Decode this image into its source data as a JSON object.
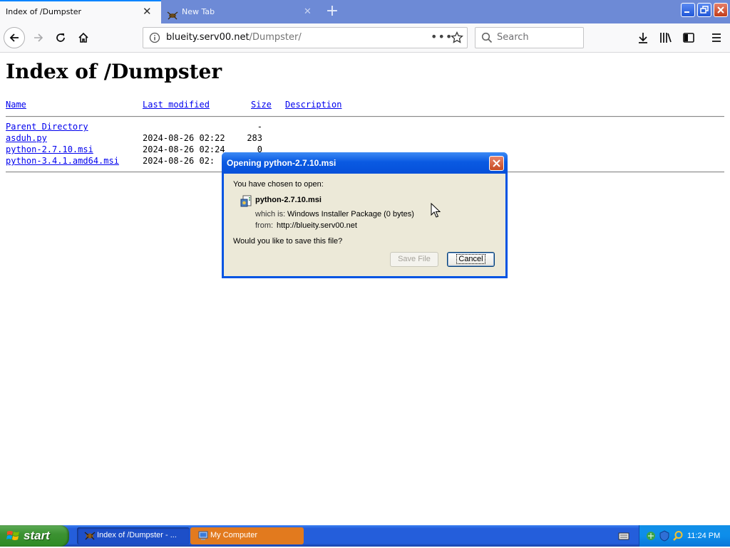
{
  "browser": {
    "tabs": [
      {
        "label": "Index of /Dumpster",
        "active": true
      },
      {
        "label": "New Tab",
        "active": false
      }
    ],
    "url": {
      "host": "blueity.serv00.net",
      "path": "/Dumpster/"
    },
    "search_placeholder": "Search",
    "accent_color": "#0a84ff",
    "icons": [
      "back-arrow-icon",
      "forward-arrow-icon",
      "reload-icon",
      "home-icon",
      "info-icon",
      "more-icon",
      "star-icon",
      "search-icon",
      "download-icon",
      "library-icon",
      "sidebar-icon",
      "hamburger-menu-icon"
    ]
  },
  "page": {
    "heading": "Index of /Dumpster",
    "columns": {
      "name": "Name",
      "modified": "Last modified",
      "size": "Size",
      "description": "Description"
    },
    "rows": [
      {
        "name": "Parent Directory",
        "modified": "",
        "size": "-"
      },
      {
        "name": "asduh.py",
        "modified": "2024-08-26 02:22",
        "size": "283"
      },
      {
        "name": "python-2.7.10.msi",
        "modified": "2024-08-26 02:24",
        "size": "0"
      },
      {
        "name": "python-3.4.1.amd64.msi",
        "modified": "2024-08-26 02:",
        "size": ""
      }
    ]
  },
  "dialog": {
    "title": "Opening python-2.7.10.msi",
    "chosen_text": "You have chosen to open:",
    "filename": "python-2.7.10.msi",
    "which_label": "which is:",
    "which_value": "Windows Installer Package (0 bytes)",
    "from_label": "from:",
    "from_value": "http://blueity.serv00.net",
    "question": "Would you like to save this file?",
    "save_label": "Save File",
    "save_enabled": false,
    "cancel_label": "Cancel"
  },
  "taskbar": {
    "start_label": "start",
    "tasks": [
      {
        "label": "Index of /Dumpster - ...",
        "icon": "firefox-icon",
        "active": true
      },
      {
        "label": "My Computer",
        "icon": "my-computer-icon",
        "active": false
      }
    ],
    "clock": "11:24 PM"
  }
}
